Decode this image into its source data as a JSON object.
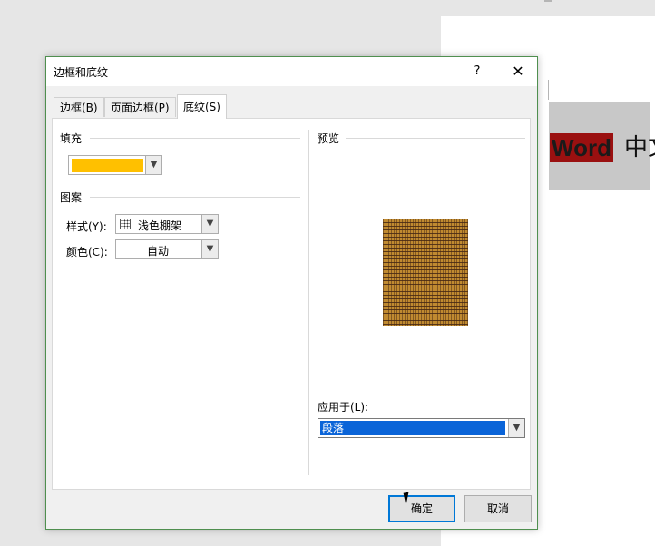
{
  "document": {
    "highlighted_word": "Word",
    "trailing_text": "中文"
  },
  "dialog": {
    "title": "边框和底纹",
    "help_label": "?",
    "close_label": "✕",
    "tabs": [
      {
        "label": "边框(B)",
        "active": false
      },
      {
        "label": "页面边框(P)",
        "active": false
      },
      {
        "label": "底纹(S)",
        "active": true
      }
    ],
    "fill": {
      "group_label": "填充",
      "color": "#ffc000"
    },
    "pattern": {
      "group_label": "图案",
      "style_label": "样式(Y):",
      "style_value": "浅色棚架",
      "color_label": "颜色(C):",
      "color_value": "自动"
    },
    "preview": {
      "group_label": "预览"
    },
    "apply_to": {
      "label": "应用于(L):",
      "value": "段落"
    },
    "buttons": {
      "ok": "确定",
      "cancel": "取消"
    }
  },
  "colors": {
    "fill_yellow": "#ffc000",
    "selection_blue": "#0a64d8",
    "dialog_border": "#4f8f4f",
    "word_highlight": "#9a1010"
  },
  "icons": {
    "dropdown": "chevron-down-icon",
    "close": "close-icon",
    "help": "help-icon"
  }
}
